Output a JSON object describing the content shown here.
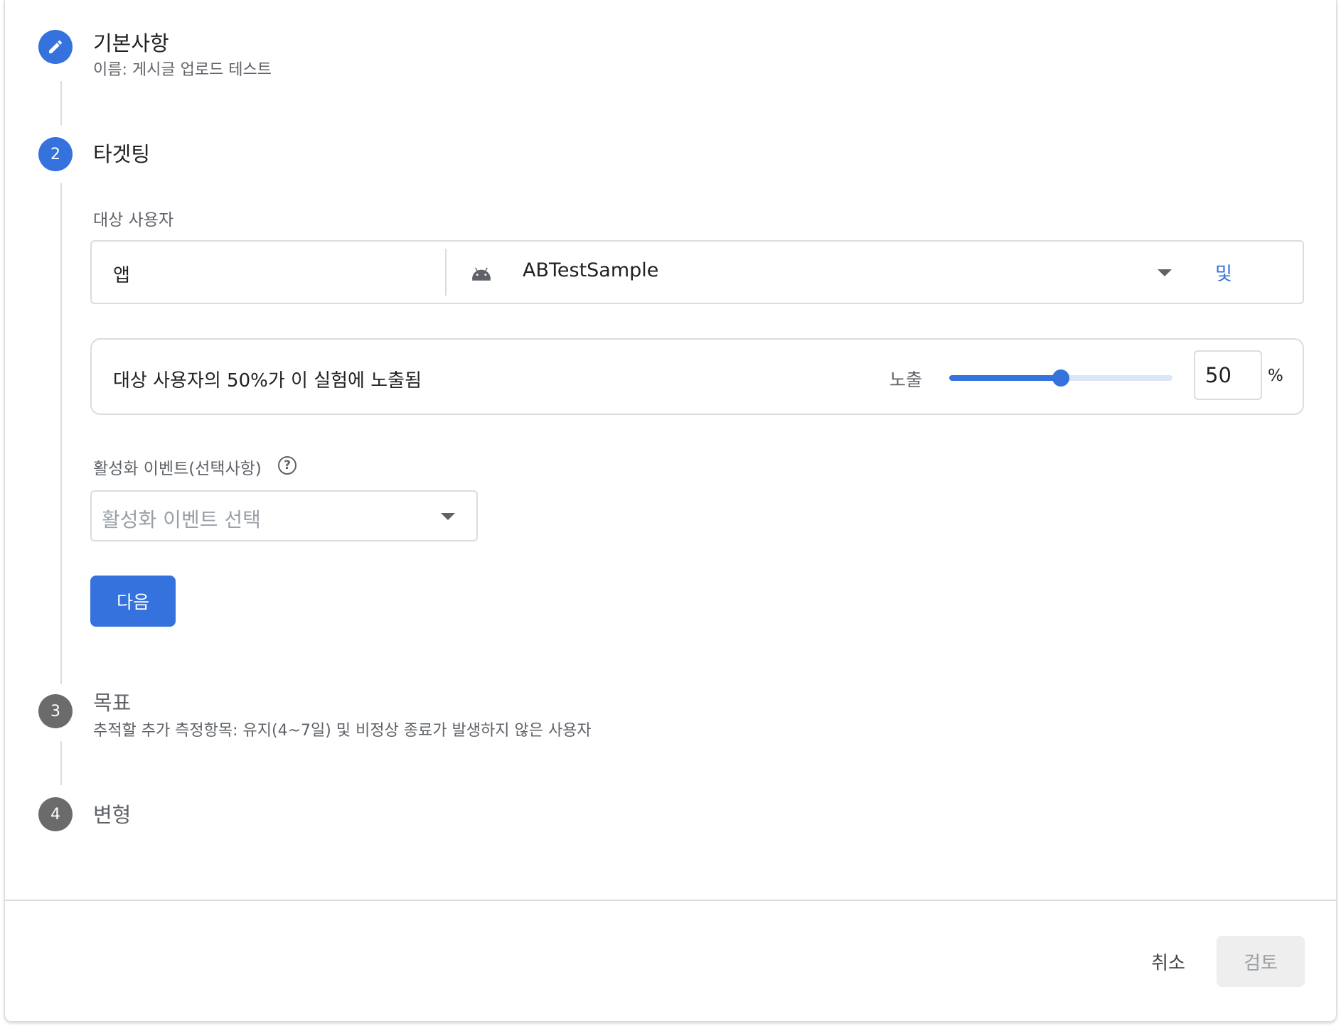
{
  "steps": [
    {
      "title": "기본사항",
      "subtitle": "이름: 게시글 업로드 테스트"
    },
    {
      "number": "2",
      "title": "타겟팅"
    },
    {
      "number": "3",
      "title": "목표",
      "subtitle": "추적할 추가 측정항목: 유지(4~7일) 및 비정상 종료가 발생하지 않은 사용자"
    },
    {
      "number": "4",
      "title": "변형"
    }
  ],
  "targeting": {
    "audience_label": "대상 사용자",
    "app_label": "앱",
    "app_name": "ABTestSample",
    "and_link": "및",
    "exposure_text": "대상 사용자의 50%가 이 실험에 노출됨",
    "exposure_label": "노출",
    "exposure_value": "50",
    "exposure_percent_fraction": 0.5,
    "percent_sign": "%",
    "activation_label": "활성화 이벤트(선택사항)",
    "activation_placeholder": "활성화 이벤트 선택",
    "next_button": "다음"
  },
  "footer": {
    "cancel": "취소",
    "review": "검토"
  },
  "icons": {
    "step1": "pencil-icon",
    "app": "android-icon",
    "help": "help-circle-icon"
  },
  "colors": {
    "accent": "#3572dd",
    "step_inactive": "#6b6b6b"
  }
}
